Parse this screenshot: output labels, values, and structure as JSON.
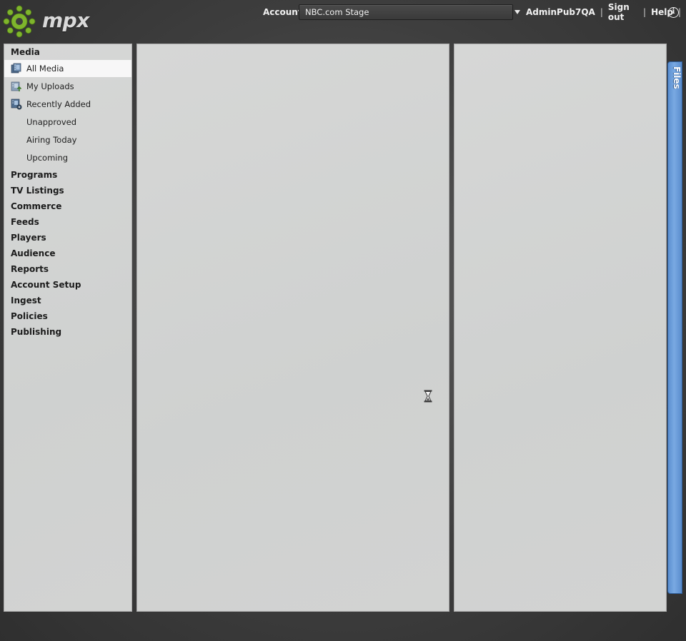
{
  "app": {
    "logo_text": "mpx"
  },
  "header": {
    "account_label": "Account:",
    "account_value": "NBC.com Stage",
    "user": "AdminPub7QA",
    "sign_out": "Sign out",
    "help": "Help",
    "separator": "|",
    "info_icon": "info-icon"
  },
  "sidebar": {
    "section_title": "Media",
    "media_items": [
      {
        "label": "All Media",
        "icon": "all-media-icon",
        "selected": true
      },
      {
        "label": "My Uploads",
        "icon": "my-uploads-icon",
        "selected": false
      },
      {
        "label": "Recently Added",
        "icon": "recently-added-icon",
        "selected": false
      },
      {
        "label": "Unapproved",
        "icon": "",
        "selected": false
      },
      {
        "label": "Airing Today",
        "icon": "",
        "selected": false
      },
      {
        "label": "Upcoming",
        "icon": "",
        "selected": false
      }
    ],
    "sections": [
      "Programs",
      "TV Listings",
      "Commerce",
      "Feeds",
      "Players",
      "Audience",
      "Reports",
      "Account Setup",
      "Ingest",
      "Policies",
      "Publishing"
    ]
  },
  "list_panel": {
    "busy_indicator": "hourglass-icon"
  },
  "files_tab": {
    "label": "Files"
  },
  "colors": {
    "header_bg": "#3e3e3e",
    "panel_bg": "#d2d3d2",
    "selected_bg": "#f7f7f7",
    "files_tab_blue": "#6a9bd8",
    "logo_green": "#7fb52c"
  }
}
